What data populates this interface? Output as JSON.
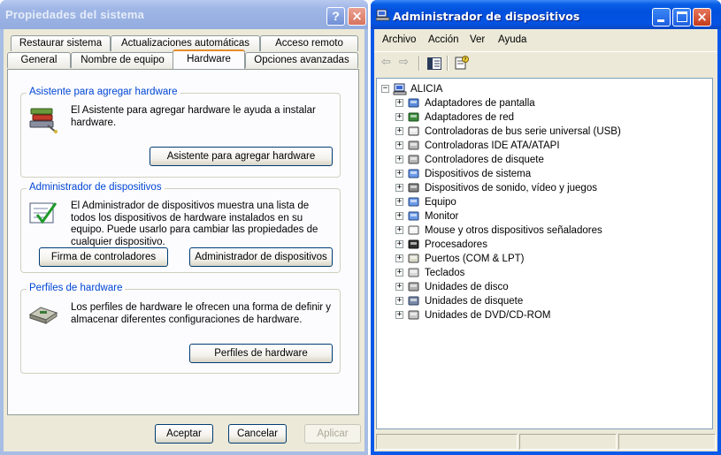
{
  "system_properties": {
    "title": "Propiedades del sistema",
    "help_glyph": "?",
    "close_glyph": "×",
    "tabs_row_back": [
      "Restaurar sistema",
      "Actualizaciones automáticas",
      "Acceso remoto"
    ],
    "tabs_row_front": [
      "General",
      "Nombre de equipo",
      "Hardware",
      "Opciones avanzadas"
    ],
    "active_tab": "Hardware",
    "groups": {
      "wizard": {
        "label": "Asistente para agregar hardware",
        "description": "El Asistente para agregar hardware le ayuda a instalar hardware.",
        "button": "Asistente para agregar hardware",
        "icon": "hardware-wizard-icon"
      },
      "device_manager": {
        "label": "Administrador de dispositivos",
        "description": "El Administrador de dispositivos muestra una lista de todos los dispositivos de hardware instalados en su equipo. Puede usarlo para cambiar las propiedades de cualquier dispositivo.",
        "button_signing": "Firma de controladores",
        "button_manager": "Administrador de dispositivos",
        "icon": "device-manager-checklist-icon"
      },
      "profiles": {
        "label": "Perfiles de hardware",
        "description": "Los perfiles de hardware le ofrecen una forma de definir y almacenar diferentes configuraciones de hardware.",
        "button": "Perfiles de hardware",
        "icon": "hardware-profiles-icon"
      }
    },
    "footer": {
      "ok": "Aceptar",
      "cancel": "Cancelar",
      "apply": "Aplicar"
    }
  },
  "device_manager_window": {
    "title": "Administrador de dispositivos",
    "close_glyph": "×",
    "menu": [
      "Archivo",
      "Acción",
      "Ver",
      "Ayuda"
    ],
    "toolbar": {
      "back_glyph": "⇦",
      "forward_glyph": "⇨"
    },
    "tree": {
      "root": "ALICIA",
      "root_expander": "−",
      "expander_glyph": "+",
      "categories": [
        {
          "label": "Adaptadores de pantalla",
          "icon": "display-adapter-icon"
        },
        {
          "label": "Adaptadores de red",
          "icon": "network-adapter-icon"
        },
        {
          "label": "Controladoras de bus serie universal (USB)",
          "icon": "usb-icon"
        },
        {
          "label": "Controladoras IDE ATA/ATAPI",
          "icon": "ide-controller-icon"
        },
        {
          "label": "Controladores de disquete",
          "icon": "floppy-controller-icon"
        },
        {
          "label": "Dispositivos de sistema",
          "icon": "system-device-icon"
        },
        {
          "label": "Dispositivos de sonido, vídeo y juegos",
          "icon": "sound-icon"
        },
        {
          "label": "Equipo",
          "icon": "computer-icon"
        },
        {
          "label": "Monitor",
          "icon": "monitor-icon"
        },
        {
          "label": "Mouse y otros dispositivos señaladores",
          "icon": "mouse-icon"
        },
        {
          "label": "Procesadores",
          "icon": "processor-icon"
        },
        {
          "label": "Puertos (COM & LPT)",
          "icon": "port-icon"
        },
        {
          "label": "Teclados",
          "icon": "keyboard-icon"
        },
        {
          "label": "Unidades de disco",
          "icon": "disk-drive-icon"
        },
        {
          "label": "Unidades de disquete",
          "icon": "floppy-drive-icon"
        },
        {
          "label": "Unidades de DVD/CD-ROM",
          "icon": "dvd-drive-icon"
        }
      ]
    }
  }
}
